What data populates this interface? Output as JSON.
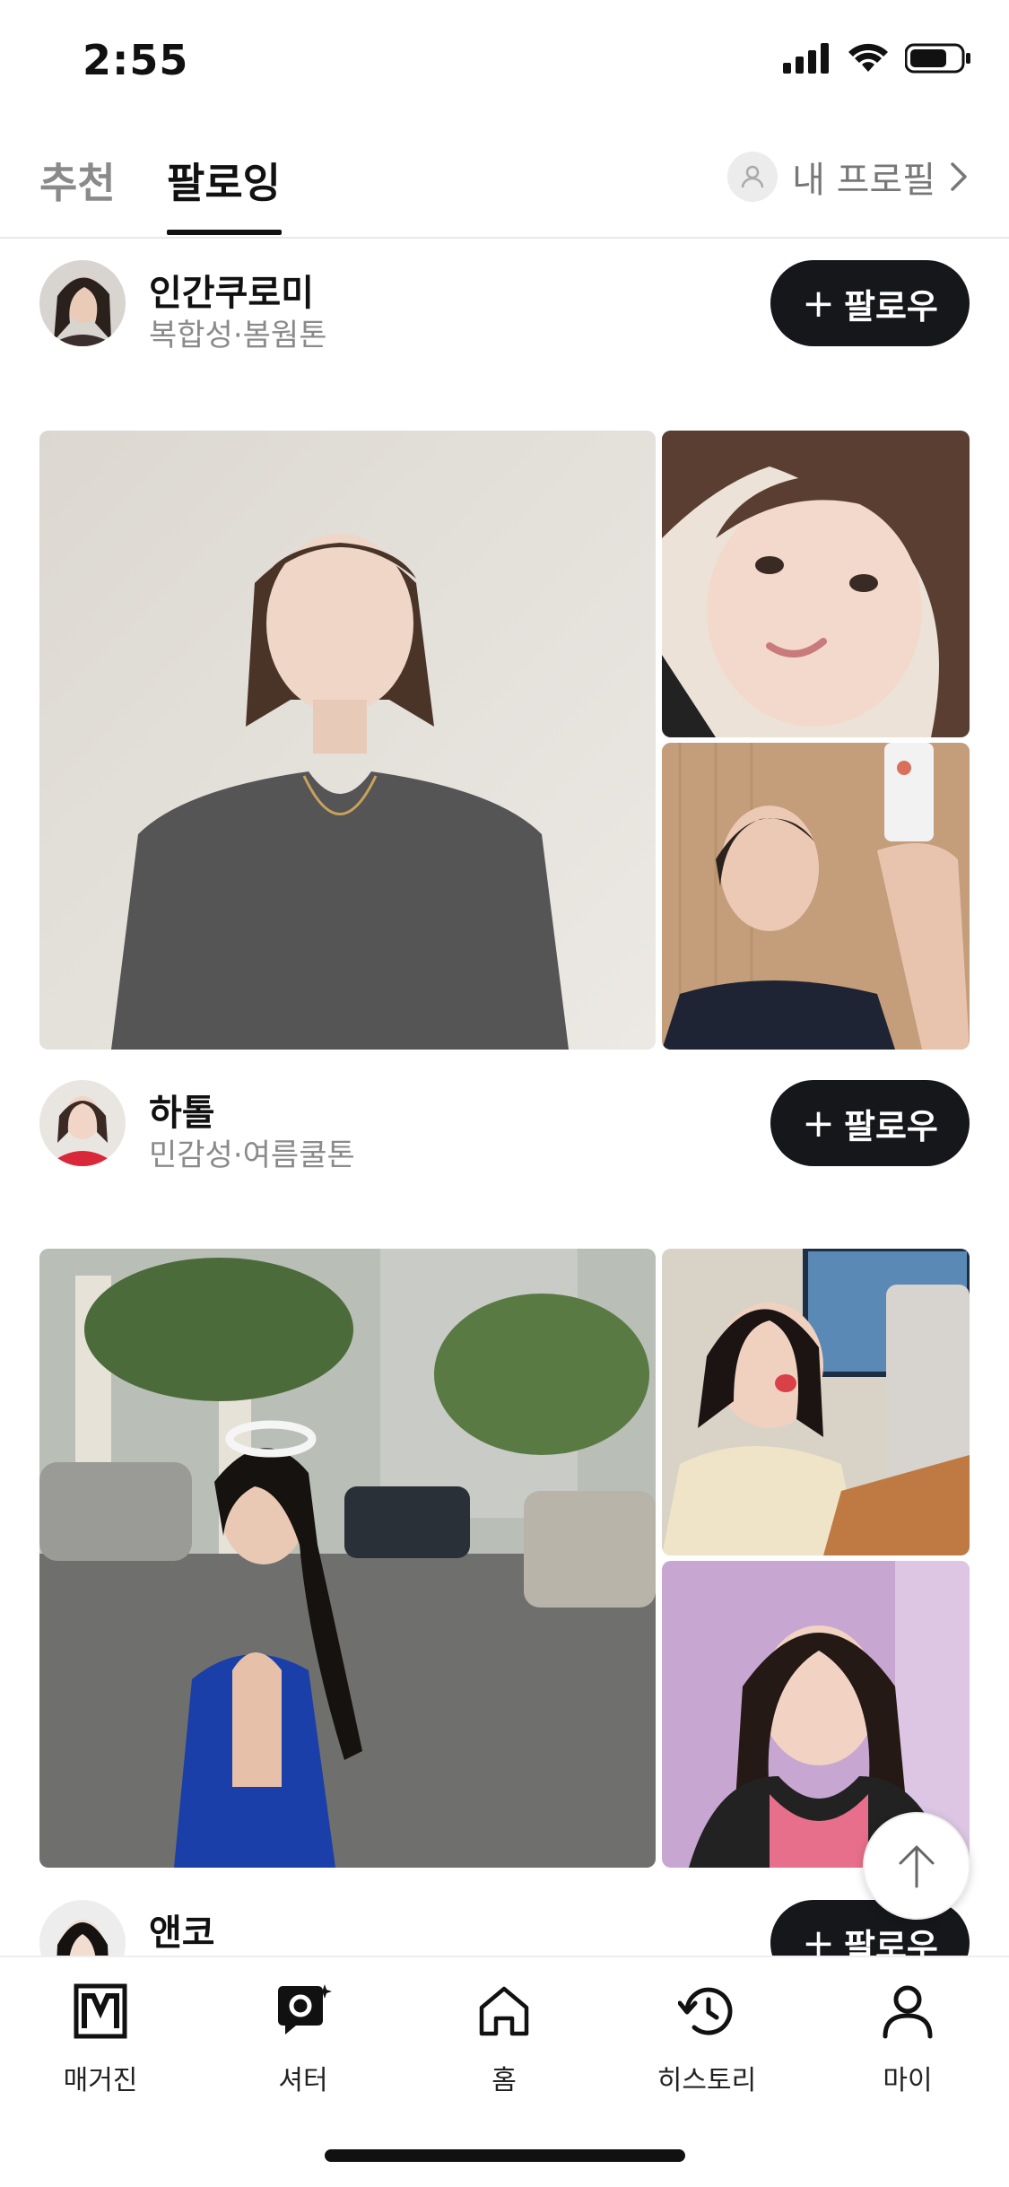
{
  "status": {
    "time": "2:55"
  },
  "tabs": {
    "recommended": "추천",
    "following": "팔로잉",
    "my_profile": "내 프로필"
  },
  "posts": [
    {
      "name": "인간쿠로미",
      "tags": "복합성·봄웜톤",
      "follow_label": "팔로우"
    },
    {
      "name": "하톨",
      "tags": "민감성·여름쿨톤",
      "follow_label": "팔로우"
    },
    {
      "name": "앤코",
      "tags": "",
      "follow_label": "팔로우"
    }
  ],
  "bottom_nav": [
    {
      "label": "매거진",
      "icon": "magazine-icon"
    },
    {
      "label": "셔터",
      "icon": "shutter-icon"
    },
    {
      "label": "홈",
      "icon": "home-icon"
    },
    {
      "label": "히스토리",
      "icon": "history-icon"
    },
    {
      "label": "마이",
      "icon": "person-icon"
    }
  ]
}
